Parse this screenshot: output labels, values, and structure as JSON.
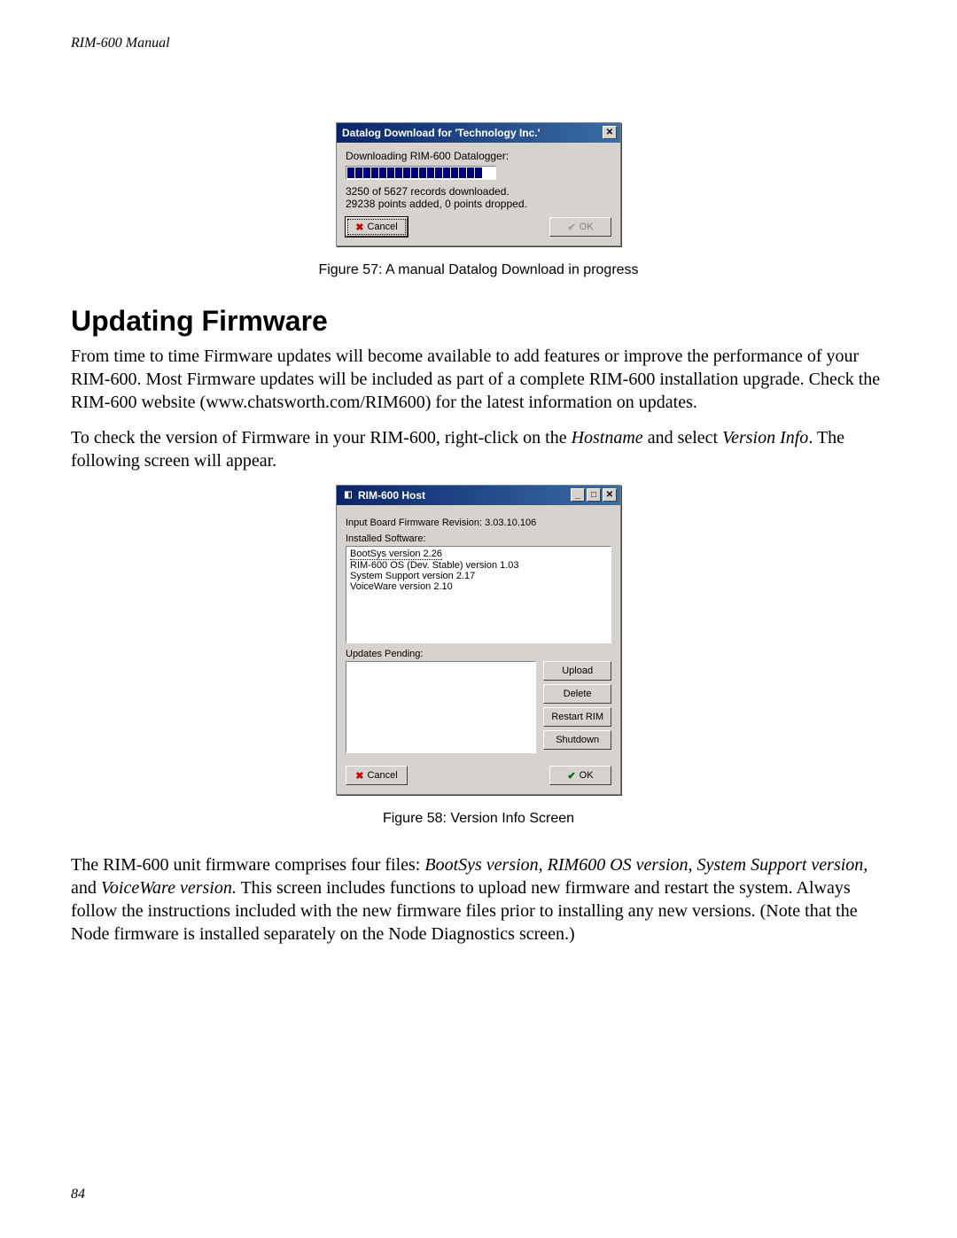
{
  "runningHead": "RIM-600  Manual",
  "pageNumber": "84",
  "dialog1": {
    "title": "Datalog Download for 'Technology Inc.'",
    "line1": "Downloading RIM-600 Datalogger:",
    "line2": "3250 of 5627 records downloaded.",
    "line3": "29238 points added, 0 points dropped.",
    "cancel": "Cancel",
    "ok": "OK"
  },
  "caption1": "Figure 57: A manual Datalog Download in progress",
  "heading1": "Updating Firmware",
  "para1a": "From time to time Firmware updates will become available to add features or improve the performance of your RIM-600. ",
  "para1b": " Most Firmware updates will be included as part of a complete RIM-600 installation upgrade. Check the RIM-600 website (www.chatsworth.com/RIM600) for the latest information on updates.",
  "para2a": "To check the version of Firmware in your RIM-600, right-click on the ",
  "para2_host": "Hostname",
  "para2b": " and select ",
  "para2_ver": "Version Info",
  "para2c": ".  The following screen will appear.",
  "dialog2": {
    "title": "RIM-600 Host",
    "revision": "Input Board Firmware Revision: 3.03.10.106",
    "installedLabel": "Installed Software:",
    "sw0": "BootSys version 2.26",
    "sw1": "RIM-600 OS (Dev. Stable) version 1.03",
    "sw2": "System Support version 2.17",
    "sw3": "VoiceWare version 2.10",
    "pendingLabel": "Updates Pending:",
    "upload": "Upload",
    "delete": "Delete",
    "restart": "Restart RIM",
    "shutdown": "Shutdown",
    "cancel": "Cancel",
    "ok": "OK"
  },
  "caption2": "Figure 58: Version Info Screen",
  "para3a": "The RIM-600 unit firmware comprises four files: ",
  "para3_i1": "BootSys version, RIM600 OS version, System Support version,",
  "para3b": " and ",
  "para3_i2": "VoiceWare version.",
  "para3c": "  This screen includes functions to upload new firmware and restart the system. Always follow the instructions included with the new firmware files prior to installing any new versions.  (Note that the Node firmware is installed separately on the Node Diagnostics screen.)"
}
